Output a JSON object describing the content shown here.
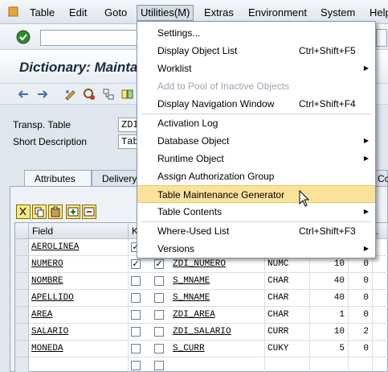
{
  "menubar": {
    "items": [
      "Table",
      "Edit",
      "Goto",
      "Utilities(M)",
      "Extras",
      "Environment",
      "System",
      "Help"
    ]
  },
  "toolbar": {
    "command_value": ""
  },
  "header": {
    "title": "Dictionary: Mainta"
  },
  "form": {
    "transp_table_label": "Transp. Table",
    "transp_table_value": "ZDI",
    "short_desc_label": "Short Description",
    "short_desc_value": "Tab"
  },
  "tabs": [
    "Attributes",
    "Delivery",
    "Co"
  ],
  "grid": {
    "headers": {
      "field": "Field",
      "key": "K",
      "right": "."
    },
    "rows": [
      {
        "field": "AEROLINEA",
        "key": true,
        "init": false,
        "elem": "",
        "type": "",
        "len": "",
        "dec": ""
      },
      {
        "field": "NUMERO",
        "key": true,
        "init": true,
        "elem": "ZDI_NUMERO",
        "type": "NUMC",
        "len": "10",
        "dec": "0"
      },
      {
        "field": "NOMBRE",
        "key": false,
        "init": false,
        "elem": "S_MNAME",
        "type": "CHAR",
        "len": "40",
        "dec": "0"
      },
      {
        "field": "APELLIDO",
        "key": false,
        "init": false,
        "elem": "S_MNAME",
        "type": "CHAR",
        "len": "40",
        "dec": "0"
      },
      {
        "field": "AREA",
        "key": false,
        "init": false,
        "elem": "ZDI_AREA",
        "type": "CHAR",
        "len": "1",
        "dec": "0"
      },
      {
        "field": "SALARIO",
        "key": false,
        "init": false,
        "elem": "ZDI_SALARIO",
        "type": "CURR",
        "len": "10",
        "dec": "2"
      },
      {
        "field": "MONEDA",
        "key": false,
        "init": false,
        "elem": "S_CURR",
        "type": "CUKY",
        "len": "5",
        "dec": "0"
      },
      {
        "field": "",
        "key": false,
        "init": false,
        "elem": "",
        "type": "",
        "len": "",
        "dec": ""
      }
    ]
  },
  "menu": {
    "settings": "Settings...",
    "display_object_list": "Display Object List",
    "display_object_list_sc": "Ctrl+Shift+F5",
    "worklist": "Worklist",
    "add_to_pool": "Add to Pool of Inactive Objects",
    "display_nav": "Display Navigation Window",
    "display_nav_sc": "Ctrl+Shift+F4",
    "activation_log": "Activation Log",
    "database_object": "Database Object",
    "runtime_object": "Runtime Object",
    "assign_auth": "Assign Authorization Group",
    "table_maint_gen": "Table Maintenance Generator",
    "table_contents": "Table Contents",
    "where_used": "Where-Used List",
    "where_used_sc": "Ctrl+Shift+F3",
    "versions": "Versions"
  },
  "colors": {
    "highlight": "#fbe29a",
    "menu_bg": "#ffffff",
    "accent_blue": "#2e6fb0"
  }
}
